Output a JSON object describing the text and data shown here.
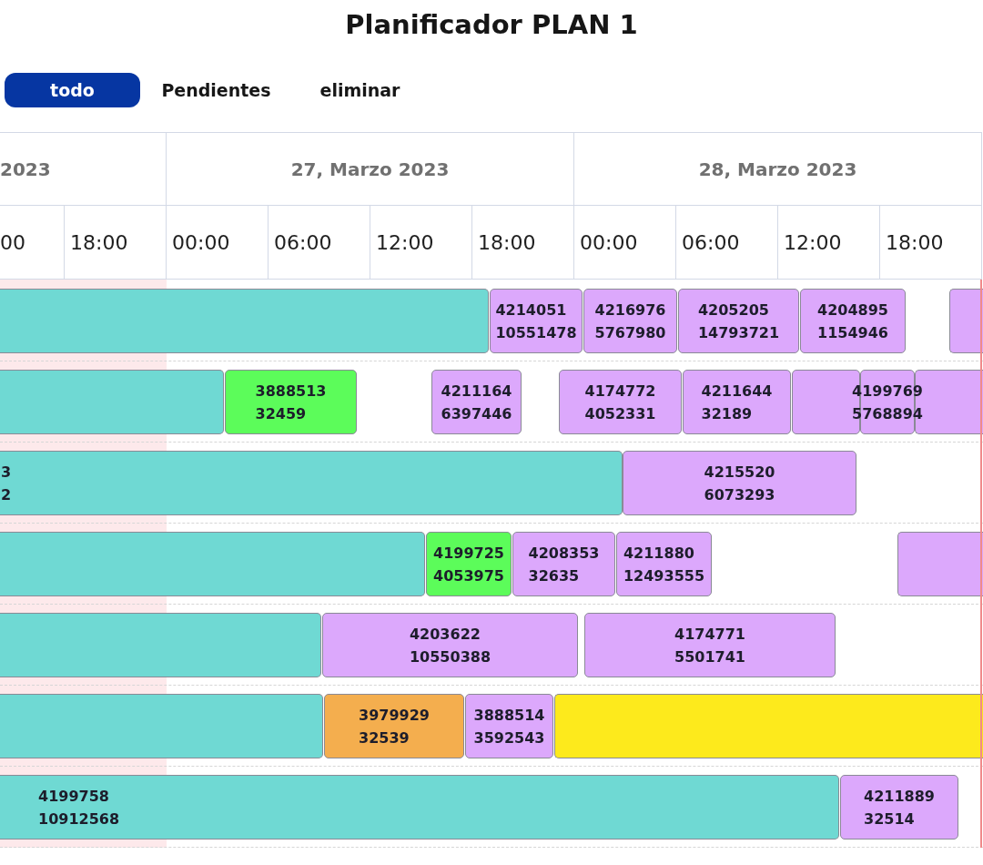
{
  "title": "Planificador PLAN 1",
  "filters": [
    {
      "label": "todo",
      "selected": true
    },
    {
      "label": "Pendientes",
      "selected": false
    },
    {
      "label": "eliminar",
      "selected": false
    }
  ],
  "timeline": {
    "days": [
      "2023",
      "27, Marzo 2023",
      "28, Marzo 2023"
    ],
    "hours": [
      "00",
      "18:00",
      "00:00",
      "06:00",
      "12:00",
      "18:00",
      "00:00",
      "06:00",
      "12:00",
      "18:00"
    ],
    "rows": [
      {
        "tasks": [
          {
            "color": "#6fd9d3"
          },
          {
            "color": "#dca8fc",
            "lines": [
              "4214051",
              "10551478"
            ]
          },
          {
            "color": "#dca8fc",
            "lines": [
              "4216976",
              "5767980"
            ]
          },
          {
            "color": "#dca8fc",
            "lines": [
              "4205205",
              "14793721"
            ]
          },
          {
            "color": "#dca8fc",
            "lines": [
              "4204895",
              "1154946"
            ]
          },
          {
            "color": "#dca8fc"
          }
        ]
      },
      {
        "tasks": [
          {
            "color": "#6fd9d3"
          },
          {
            "color": "#5cfc5a",
            "lines": [
              "3888513",
              "32459"
            ]
          },
          {
            "color": "#dca8fc",
            "lines": [
              "4211164",
              "6397446"
            ]
          },
          {
            "color": "#dca8fc",
            "lines": [
              "4174772",
              "4052331"
            ]
          },
          {
            "color": "#dca8fc",
            "lines": [
              "4211644",
              "32189"
            ]
          },
          {
            "color": "#dca8fc"
          },
          {
            "color": "#dca8fc",
            "lines": [
              "4199769",
              "5768894"
            ]
          },
          {
            "color": "#dca8fc"
          }
        ]
      },
      {
        "tasks": [
          {
            "color": "#6fd9d3",
            "lines": [
              "3",
              "2"
            ]
          },
          {
            "color": "#dca8fc",
            "lines": [
              "4215520",
              "6073293"
            ]
          }
        ]
      },
      {
        "tasks": [
          {
            "color": "#6fd9d3"
          },
          {
            "color": "#5cfc5a",
            "lines": [
              "4199725",
              "4053975"
            ]
          },
          {
            "color": "#dca8fc",
            "lines": [
              "4208353",
              "32635"
            ]
          },
          {
            "color": "#dca8fc",
            "lines": [
              "4211880",
              "12493555"
            ]
          },
          {
            "color": "#dca8fc"
          }
        ]
      },
      {
        "tasks": [
          {
            "color": "#6fd9d3"
          },
          {
            "color": "#dca8fc",
            "lines": [
              "4203622",
              "10550388"
            ]
          },
          {
            "color": "#dca8fc",
            "lines": [
              "4174771",
              "5501741"
            ]
          }
        ]
      },
      {
        "tasks": [
          {
            "color": "#6fd9d3"
          },
          {
            "color": "#f4ae4e",
            "lines": [
              "3979929",
              "32539"
            ]
          },
          {
            "color": "#dca8fc",
            "lines": [
              "3888514",
              "3592543"
            ]
          },
          {
            "color": "#fdea1c"
          }
        ]
      },
      {
        "tasks": [
          {
            "color": "#6fd9d3",
            "lines": [
              "4199758",
              "10912568"
            ]
          },
          {
            "color": "#dca8fc",
            "lines": [
              "4211889",
              "32514"
            ]
          }
        ]
      }
    ]
  }
}
